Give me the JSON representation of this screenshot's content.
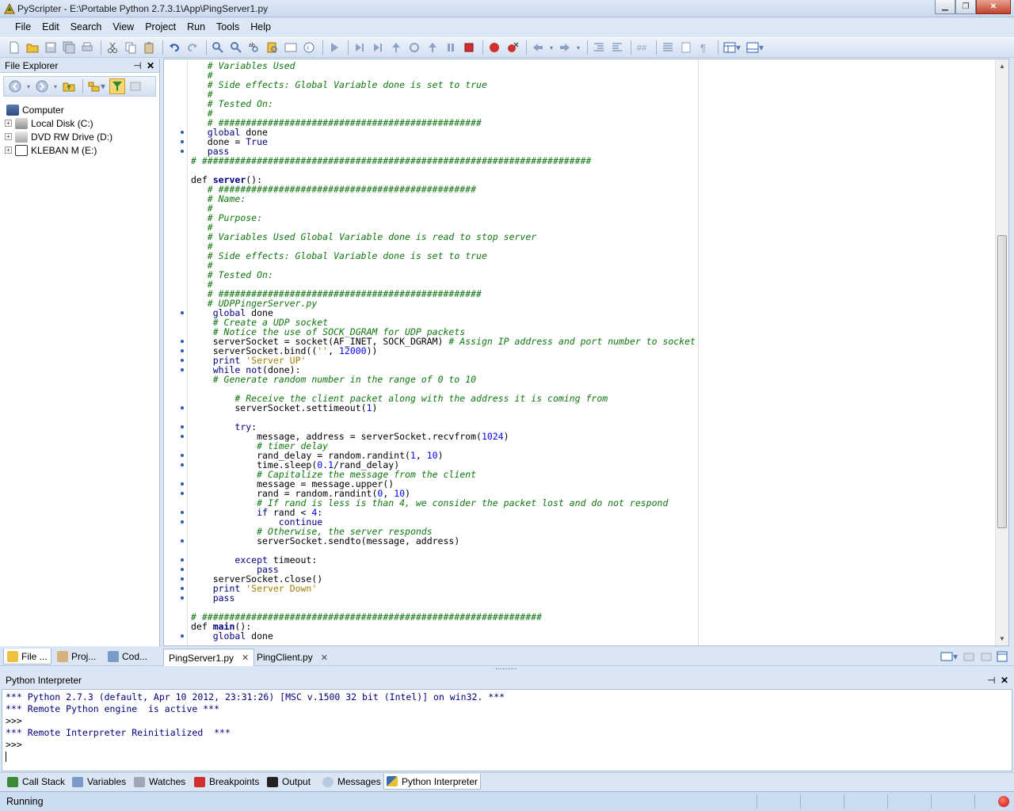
{
  "window": {
    "title": "PyScripter - E:\\Portable Python 2.7.3.1\\App\\PingServer1.py",
    "controls": [
      "minimize",
      "maximize",
      "close"
    ]
  },
  "menubar": {
    "items": [
      "File",
      "Edit",
      "Search",
      "View",
      "Project",
      "Run",
      "Tools",
      "Help"
    ]
  },
  "toolbar": {
    "icons": [
      "new-file-icon",
      "open-folder-icon",
      "save-icon",
      "save-all-icon",
      "print-icon",
      "cut-icon",
      "copy-icon",
      "paste-icon",
      "undo-icon",
      "redo-icon",
      "find-icon",
      "find-next-icon",
      "replace-icon",
      "find-in-files-icon",
      "goto-icon",
      "debug-icon",
      "run-icon",
      "step-into-icon",
      "step-over-icon",
      "step-out-icon",
      "run-to-cursor-icon",
      "pause-icon",
      "stop-icon",
      "breakpoint-icon",
      "clear-breakpoints-icon",
      "back-icon",
      "forward-icon",
      "indent-icon",
      "dedent-icon",
      "comment-icon",
      "uncomment-icon",
      "tabify-icon",
      "show-whitespace-icon",
      "layout-icon",
      "layout2-icon"
    ]
  },
  "file_explorer": {
    "title": "File Explorer",
    "pin": "⊣",
    "close": "✕",
    "tree": [
      {
        "label": "Computer",
        "expandable": false,
        "level": 0
      },
      {
        "label": "Local Disk (C:)",
        "expandable": true,
        "level": 1
      },
      {
        "label": "DVD RW Drive (D:)",
        "expandable": true,
        "level": 1
      },
      {
        "label": "KLEBAN M (E:)",
        "expandable": true,
        "level": 1
      }
    ]
  },
  "editor": {
    "lines": [
      {
        "indent": 3,
        "text": "# Variables Used",
        "type": "cm",
        "dot": false
      },
      {
        "indent": 3,
        "text": "#",
        "type": "cm",
        "dot": false
      },
      {
        "indent": 3,
        "text": "# Side effects: Global Variable done is set to true",
        "type": "cm",
        "dot": false
      },
      {
        "indent": 3,
        "text": "#",
        "type": "cm",
        "dot": false
      },
      {
        "indent": 3,
        "text": "# Tested On:",
        "type": "cm",
        "dot": false
      },
      {
        "indent": 3,
        "text": "#",
        "type": "cm",
        "dot": false
      },
      {
        "indent": 3,
        "text": "# ################################################",
        "type": "cm",
        "dot": false
      },
      {
        "indent": 3,
        "text": "global done",
        "type": "code",
        "dot": true
      },
      {
        "indent": 3,
        "text": "done = True",
        "type": "code",
        "dot": true
      },
      {
        "indent": 3,
        "text": "pass",
        "type": "code",
        "dot": true
      },
      {
        "indent": 0,
        "text": "# #######################################################################",
        "type": "cm",
        "dot": false
      },
      {
        "indent": 0,
        "text": "",
        "type": "code",
        "dot": false
      },
      {
        "indent": 0,
        "text": "def server():",
        "type": "def",
        "dot": false
      },
      {
        "indent": 3,
        "text": "# ###############################################",
        "type": "cm",
        "dot": false
      },
      {
        "indent": 3,
        "text": "# Name:",
        "type": "cm",
        "dot": false
      },
      {
        "indent": 3,
        "text": "#",
        "type": "cm",
        "dot": false
      },
      {
        "indent": 3,
        "text": "# Purpose:",
        "type": "cm",
        "dot": false
      },
      {
        "indent": 3,
        "text": "#",
        "type": "cm",
        "dot": false
      },
      {
        "indent": 3,
        "text": "# Variables Used Global Variable done is read to stop server",
        "type": "cm",
        "dot": false
      },
      {
        "indent": 3,
        "text": "#",
        "type": "cm",
        "dot": false
      },
      {
        "indent": 3,
        "text": "# Side effects: Global Variable done is set to true",
        "type": "cm",
        "dot": false
      },
      {
        "indent": 3,
        "text": "#",
        "type": "cm",
        "dot": false
      },
      {
        "indent": 3,
        "text": "# Tested On:",
        "type": "cm",
        "dot": false
      },
      {
        "indent": 3,
        "text": "#",
        "type": "cm",
        "dot": false
      },
      {
        "indent": 3,
        "text": "# ################################################",
        "type": "cm",
        "dot": false
      },
      {
        "indent": 3,
        "text": "# UDPPingerServer.py",
        "type": "cm",
        "dot": false
      },
      {
        "indent": 4,
        "text": "global done",
        "type": "code",
        "dot": true
      },
      {
        "indent": 4,
        "text": "# Create a UDP socket",
        "type": "cm",
        "dot": false
      },
      {
        "indent": 4,
        "text": "# Notice the use of SOCK_DGRAM for UDP packets",
        "type": "cm",
        "dot": false
      },
      {
        "indent": 4,
        "text": "serverSocket = socket(AF_INET, SOCK_DGRAM)",
        "type": "code",
        "dot": true,
        "trail": " # Assign IP address and port number to socket"
      },
      {
        "indent": 4,
        "text": "serverSocket.bind(('', 12000))",
        "type": "code",
        "dot": true
      },
      {
        "indent": 4,
        "text": "print 'Server UP'",
        "type": "code",
        "dot": true
      },
      {
        "indent": 4,
        "text": "while not(done):",
        "type": "code",
        "dot": true
      },
      {
        "indent": 4,
        "text": "# Generate random number in the range of 0 to 10",
        "type": "cm",
        "dot": false
      },
      {
        "indent": 0,
        "text": "",
        "type": "code",
        "dot": false
      },
      {
        "indent": 8,
        "text": "# Receive the client packet along with the address it is coming from",
        "type": "cm",
        "dot": false
      },
      {
        "indent": 8,
        "text": "serverSocket.settimeout(1)",
        "type": "code",
        "dot": true
      },
      {
        "indent": 0,
        "text": "",
        "type": "code",
        "dot": false
      },
      {
        "indent": 8,
        "text": "try:",
        "type": "code",
        "dot": true
      },
      {
        "indent": 12,
        "text": "message, address = serverSocket.recvfrom(1024)",
        "type": "code",
        "dot": true
      },
      {
        "indent": 12,
        "text": "# timer delay",
        "type": "cm",
        "dot": false
      },
      {
        "indent": 12,
        "text": "rand_delay = random.randint(1, 10)",
        "type": "code",
        "dot": true
      },
      {
        "indent": 12,
        "text": "time.sleep(0.1/rand_delay)",
        "type": "code",
        "dot": true
      },
      {
        "indent": 12,
        "text": "# Capitalize the message from the client",
        "type": "cm",
        "dot": false
      },
      {
        "indent": 12,
        "text": "message = message.upper()",
        "type": "code",
        "dot": true
      },
      {
        "indent": 12,
        "text": "rand = random.randint(0, 10)",
        "type": "code",
        "dot": true
      },
      {
        "indent": 12,
        "text": "# If rand is less is than 4, we consider the packet lost and do not respond",
        "type": "cm",
        "dot": false
      },
      {
        "indent": 12,
        "text": "if rand < 4:",
        "type": "code",
        "dot": true
      },
      {
        "indent": 16,
        "text": "continue",
        "type": "code",
        "dot": true
      },
      {
        "indent": 12,
        "text": "# Otherwise, the server responds",
        "type": "cm",
        "dot": false
      },
      {
        "indent": 12,
        "text": "serverSocket.sendto(message, address)",
        "type": "code",
        "dot": true
      },
      {
        "indent": 0,
        "text": "",
        "type": "code",
        "dot": false
      },
      {
        "indent": 8,
        "text": "except timeout:",
        "type": "code",
        "dot": true
      },
      {
        "indent": 12,
        "text": "pass",
        "type": "code",
        "dot": true
      },
      {
        "indent": 4,
        "text": "serverSocket.close()",
        "type": "code",
        "dot": true
      },
      {
        "indent": 4,
        "text": "print 'Server Down'",
        "type": "code",
        "dot": true
      },
      {
        "indent": 4,
        "text": "pass",
        "type": "code",
        "dot": true
      },
      {
        "indent": 0,
        "text": "",
        "type": "code",
        "dot": false
      },
      {
        "indent": 0,
        "text": "# ##############################################################",
        "type": "cm",
        "dot": false
      },
      {
        "indent": 0,
        "text": "def main():",
        "type": "def",
        "dot": false
      },
      {
        "indent": 4,
        "text": "global done",
        "type": "code",
        "dot": true
      }
    ]
  },
  "left_tabs": [
    {
      "label": "File ...",
      "icon": "file-explorer-icon"
    },
    {
      "label": "Proj...",
      "icon": "project-icon"
    },
    {
      "label": "Cod...",
      "icon": "code-explorer-icon"
    }
  ],
  "editor_tabs": [
    {
      "label": "PingServer1.py",
      "active": true,
      "close": "✕"
    },
    {
      "label": "PingClient.py",
      "active": false,
      "close": "✕"
    }
  ],
  "interpreter": {
    "title": "Python Interpreter",
    "pin": "⊣",
    "close": "✕",
    "lines": [
      "*** Python 2.7.3 (default, Apr 10 2012, 23:31:26) [MSC v.1500 32 bit (Intel)] on win32. ***",
      "*** Remote Python engine  is active ***",
      ">>>",
      "*** Remote Interpreter Reinitialized  ***",
      ">>>"
    ]
  },
  "bottom_tabs": [
    {
      "label": "Call Stack",
      "icon": "call-stack-icon",
      "active": false
    },
    {
      "label": "Variables",
      "icon": "variables-icon",
      "active": false
    },
    {
      "label": "Watches",
      "icon": "watches-icon",
      "active": false
    },
    {
      "label": "Breakpoints",
      "icon": "breakpoints-icon",
      "active": false
    },
    {
      "label": "Output",
      "icon": "output-icon",
      "active": false
    },
    {
      "label": "Messages",
      "icon": "messages-icon",
      "active": false
    },
    {
      "label": "Python Interpreter",
      "icon": "python-icon",
      "active": true
    }
  ],
  "status": {
    "text": "Running"
  },
  "colors": {
    "comment": "#107810",
    "keyword": "#000080",
    "number": "#0000ff",
    "string": "#a08000",
    "chrome": "#dbe6f4"
  }
}
